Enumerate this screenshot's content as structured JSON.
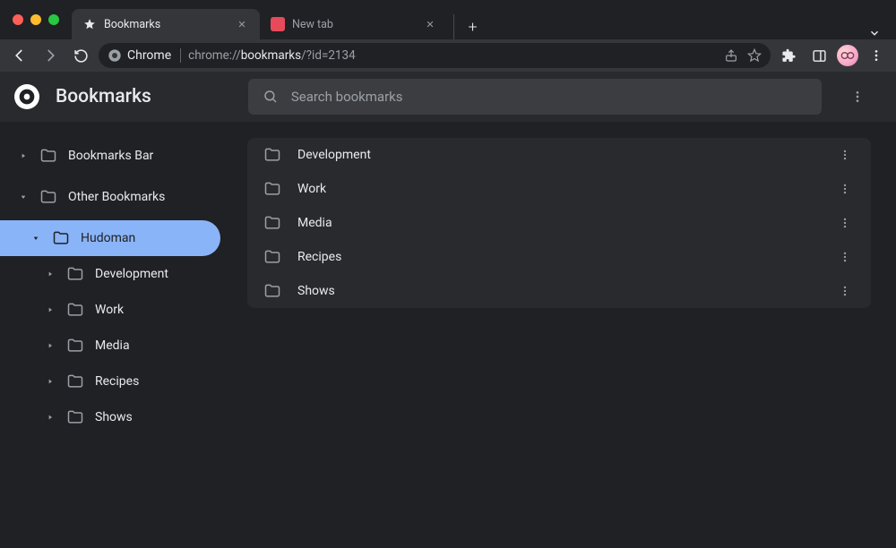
{
  "browser": {
    "tabs": [
      {
        "title": "Bookmarks",
        "favicon": "star",
        "active": true
      },
      {
        "title": "New tab",
        "favicon": "newtab",
        "active": false
      }
    ],
    "url_prefix": "chrome://",
    "url_bold": "bookmarks",
    "url_suffix": "/?id=2134",
    "omnibox_label": "Chrome"
  },
  "app": {
    "title": "Bookmarks",
    "search_placeholder": "Search bookmarks"
  },
  "sidebar": [
    {
      "label": "Bookmarks Bar",
      "depth": 0,
      "expanded": false,
      "selected": false
    },
    {
      "label": "Other Bookmarks",
      "depth": 0,
      "expanded": true,
      "selected": false
    },
    {
      "label": "Hudoman",
      "depth": 1,
      "expanded": true,
      "selected": true
    },
    {
      "label": "Development",
      "depth": 2,
      "expanded": false,
      "selected": false
    },
    {
      "label": "Work",
      "depth": 2,
      "expanded": false,
      "selected": false
    },
    {
      "label": "Media",
      "depth": 2,
      "expanded": false,
      "selected": false
    },
    {
      "label": "Recipes",
      "depth": 2,
      "expanded": false,
      "selected": false
    },
    {
      "label": "Shows",
      "depth": 2,
      "expanded": false,
      "selected": false
    }
  ],
  "folders": [
    {
      "name": "Development"
    },
    {
      "name": "Work"
    },
    {
      "name": "Media"
    },
    {
      "name": "Recipes"
    },
    {
      "name": "Shows"
    }
  ]
}
